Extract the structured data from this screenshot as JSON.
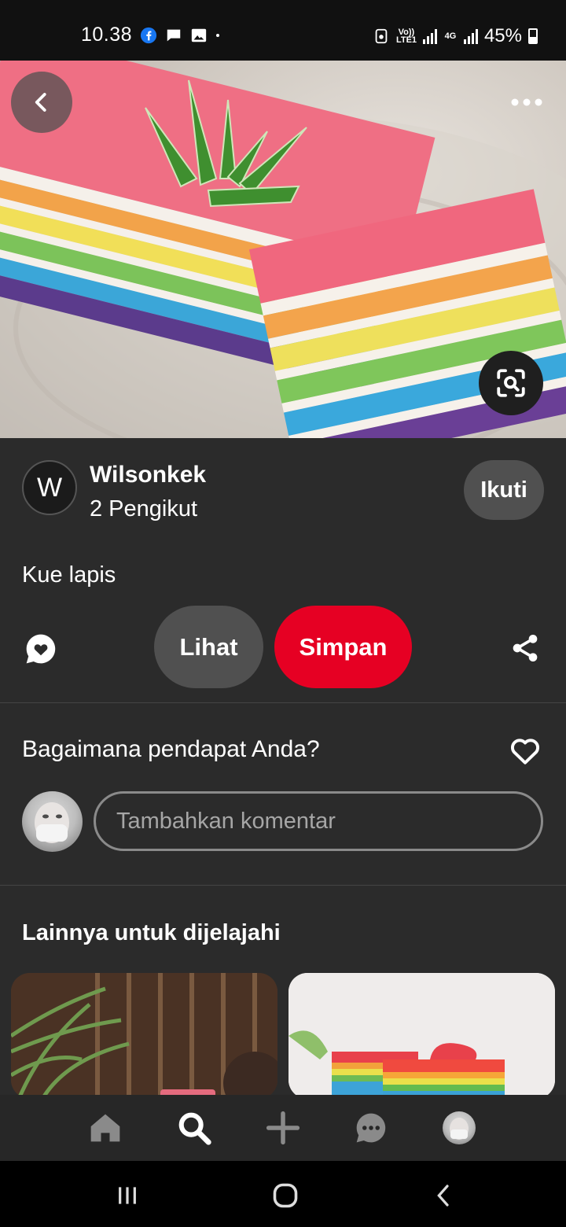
{
  "status_bar": {
    "time": "10.38",
    "network_1": "Vo)) LTE1",
    "network_2": "4G",
    "battery": "45%",
    "icons": [
      "facebook-icon",
      "chat-icon",
      "gallery-icon",
      "dot-icon",
      "nfc-icon",
      "signal-icon",
      "signal-icon",
      "battery-icon"
    ]
  },
  "hero": {
    "back_icon": "chevron-left-icon",
    "more_icon": "more-horizontal-icon",
    "lens_icon": "visual-search-icon"
  },
  "author": {
    "initial": "W",
    "name": "Wilsonkek",
    "followers": "2 Pengikut",
    "follow_label": "Ikuti"
  },
  "pin": {
    "title": "Kue lapis"
  },
  "actions": {
    "comment_icon": "message-heart-icon",
    "view_label": "Lihat",
    "save_label": "Simpan",
    "share_icon": "share-icon"
  },
  "comments": {
    "prompt": "Bagaimana pendapat Anda?",
    "like_icon": "heart-icon",
    "placeholder": "Tambahkan komentar"
  },
  "explore": {
    "title": "Lainnya untuk dijelajahi"
  },
  "bottom_nav": {
    "items": [
      "home-icon",
      "search-icon",
      "plus-icon",
      "messages-icon",
      "profile-avatar"
    ]
  },
  "system_nav": {
    "items": [
      "recents-icon",
      "home-circle-icon",
      "back-icon"
    ]
  },
  "colors": {
    "background": "#2b2b2b",
    "save_red": "#e60023",
    "pill_gray": "#505050"
  }
}
